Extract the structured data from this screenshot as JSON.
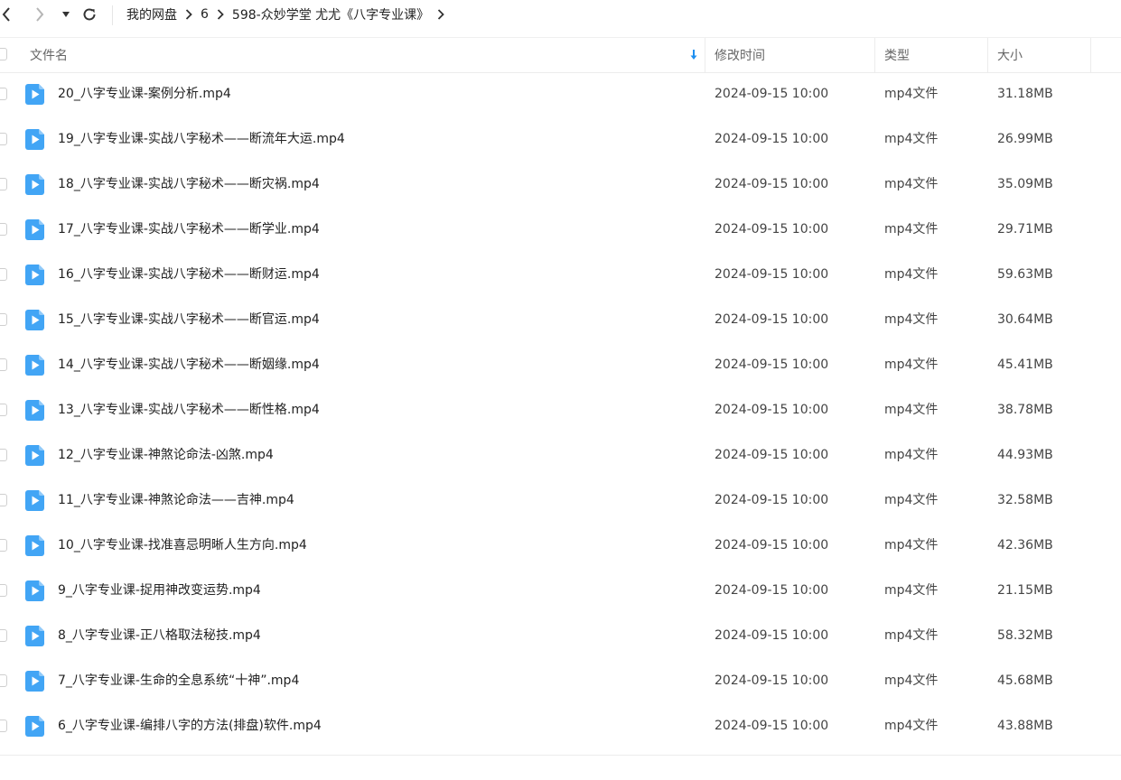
{
  "nav": {
    "breadcrumbs": [
      "我的网盘",
      "6",
      "598-众妙学堂 尤尤《八字专业课》"
    ]
  },
  "header": {
    "name": "文件名",
    "modified": "修改时间",
    "type": "类型",
    "size": "大小"
  },
  "colors": {
    "accent": "#1e8ff0",
    "file_icon": "#42a5f5"
  },
  "files": [
    {
      "name": "20_八字专业课-案例分析.mp4",
      "date": "2024-09-15 10:00",
      "type": "mp4文件",
      "size": "31.18MB"
    },
    {
      "name": "19_八字专业课-实战八字秘术——断流年大运.mp4",
      "date": "2024-09-15 10:00",
      "type": "mp4文件",
      "size": "26.99MB"
    },
    {
      "name": "18_八字专业课-实战八字秘术——断灾祸.mp4",
      "date": "2024-09-15 10:00",
      "type": "mp4文件",
      "size": "35.09MB"
    },
    {
      "name": "17_八字专业课-实战八字秘术——断学业.mp4",
      "date": "2024-09-15 10:00",
      "type": "mp4文件",
      "size": "29.71MB"
    },
    {
      "name": "16_八字专业课-实战八字秘术——断财运.mp4",
      "date": "2024-09-15 10:00",
      "type": "mp4文件",
      "size": "59.63MB"
    },
    {
      "name": "15_八字专业课-实战八字秘术——断官运.mp4",
      "date": "2024-09-15 10:00",
      "type": "mp4文件",
      "size": "30.64MB"
    },
    {
      "name": "14_八字专业课-实战八字秘术——断姻缘.mp4",
      "date": "2024-09-15 10:00",
      "type": "mp4文件",
      "size": "45.41MB"
    },
    {
      "name": "13_八字专业课-实战八字秘术——断性格.mp4",
      "date": "2024-09-15 10:00",
      "type": "mp4文件",
      "size": "38.78MB"
    },
    {
      "name": "12_八字专业课-神煞论命法-凶煞.mp4",
      "date": "2024-09-15 10:00",
      "type": "mp4文件",
      "size": "44.93MB"
    },
    {
      "name": "11_八字专业课-神煞论命法——吉神.mp4",
      "date": "2024-09-15 10:00",
      "type": "mp4文件",
      "size": "32.58MB"
    },
    {
      "name": "10_八字专业课-找准喜忌明晰人生方向.mp4",
      "date": "2024-09-15 10:00",
      "type": "mp4文件",
      "size": "42.36MB"
    },
    {
      "name": "9_八字专业课-捉用神改变运势.mp4",
      "date": "2024-09-15 10:00",
      "type": "mp4文件",
      "size": "21.15MB"
    },
    {
      "name": "8_八字专业课-正八格取法秘技.mp4",
      "date": "2024-09-15 10:00",
      "type": "mp4文件",
      "size": "58.32MB"
    },
    {
      "name": "7_八字专业课-生命的全息系统“十神”.mp4",
      "date": "2024-09-15 10:00",
      "type": "mp4文件",
      "size": "45.68MB"
    },
    {
      "name": "6_八字专业课-编排八字的方法(排盘)软件.mp4",
      "date": "2024-09-15 10:00",
      "type": "mp4文件",
      "size": "43.88MB"
    }
  ]
}
